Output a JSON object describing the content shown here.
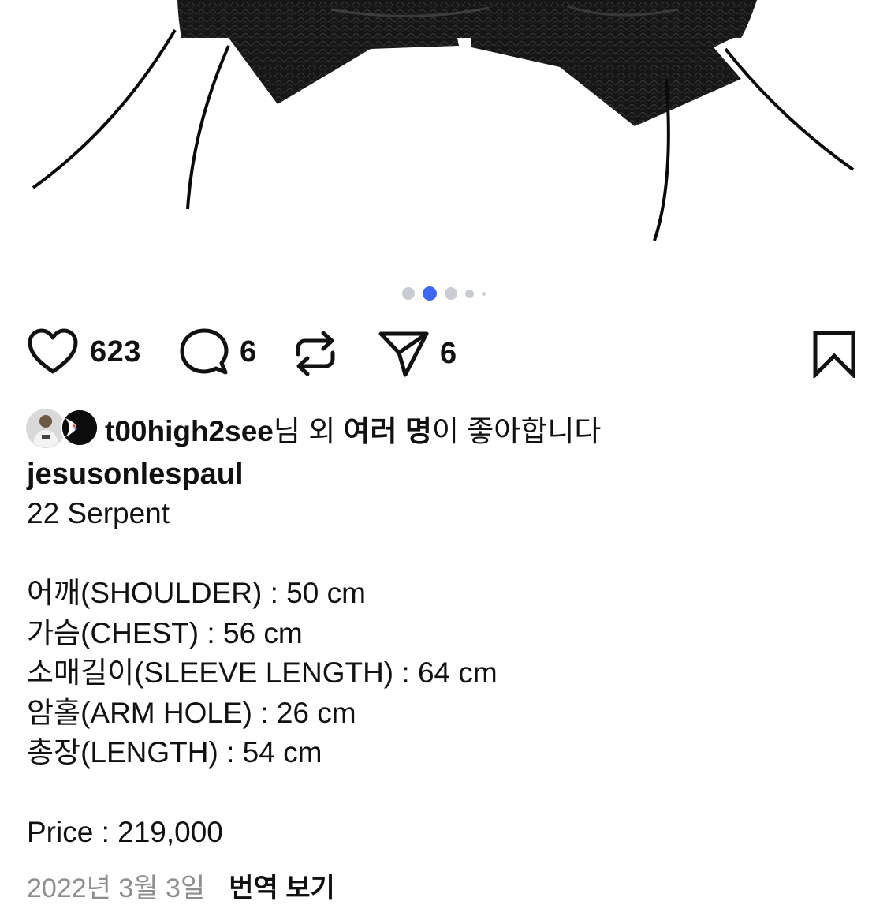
{
  "carousel": {
    "count": 5,
    "active_index": 1
  },
  "actions": {
    "like_count": "623",
    "comment_count": "6",
    "share_count": "6"
  },
  "likes": {
    "user": "t00high2see",
    "suffix": "님 외 ",
    "others": "여러 명",
    "end": "이 좋아합니다"
  },
  "caption": {
    "username": "jesusonlespaul",
    "title": "22 Serpent",
    "measurements": [
      "어깨(SHOULDER) : 50 cm",
      "가슴(CHEST) : 56 cm",
      "소매길이(SLEEVE LENGTH) : 64 cm",
      "암홀(ARM HOLE) : 26 cm",
      "총장(LENGTH) : 54 cm"
    ],
    "price": "Price : 219,000"
  },
  "footer": {
    "date": "2022년 3월 3일",
    "translate": "번역 보기"
  },
  "colors": {
    "accent_dot": "#3e66f0",
    "inactive_dot": "#c9ccd2"
  }
}
